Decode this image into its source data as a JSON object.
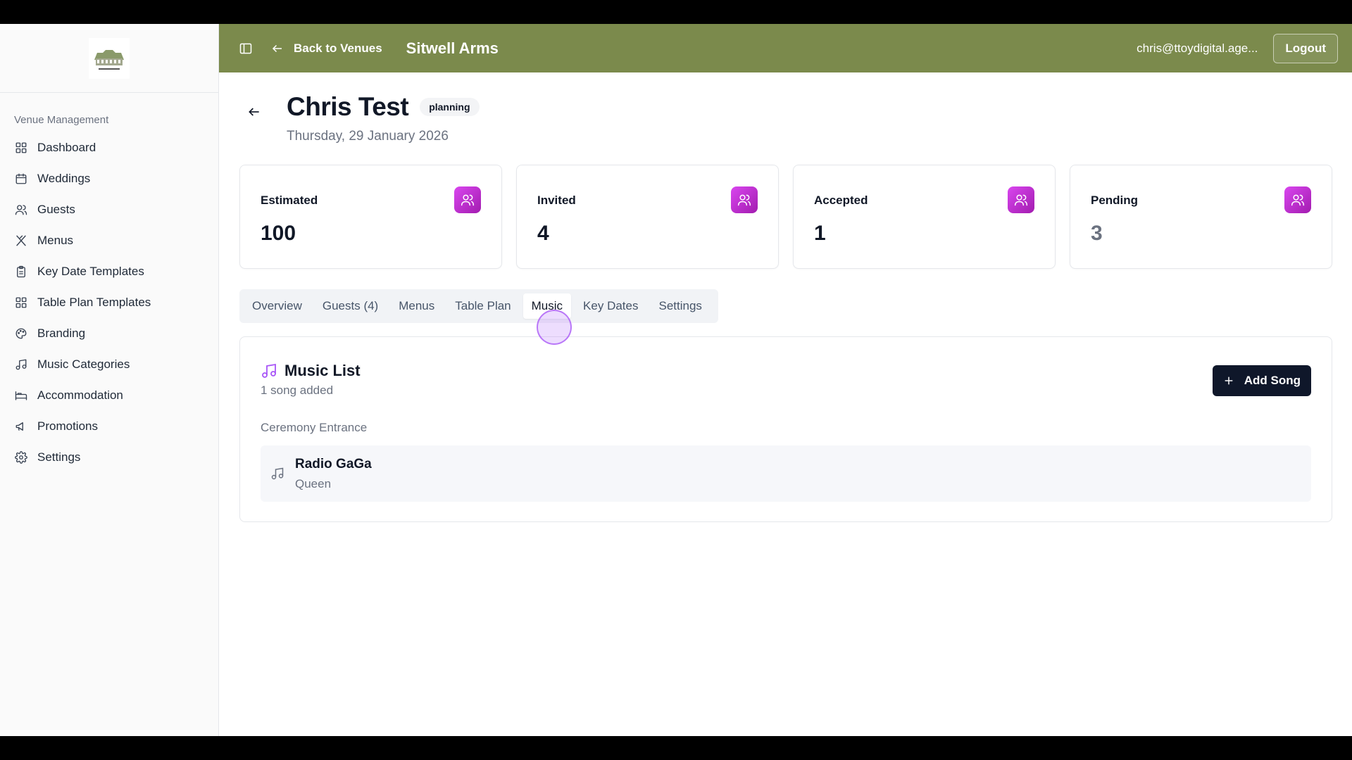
{
  "sidebar": {
    "section_label": "Venue Management",
    "items": [
      {
        "label": "Dashboard",
        "icon": "grid-icon"
      },
      {
        "label": "Weddings",
        "icon": "calendar-icon"
      },
      {
        "label": "Guests",
        "icon": "users-icon"
      },
      {
        "label": "Menus",
        "icon": "utensils-icon"
      },
      {
        "label": "Key Date Templates",
        "icon": "clipboard-icon"
      },
      {
        "label": "Table Plan Templates",
        "icon": "grid-icon"
      },
      {
        "label": "Branding",
        "icon": "palette-icon"
      },
      {
        "label": "Music Categories",
        "icon": "music-icon"
      },
      {
        "label": "Accommodation",
        "icon": "bed-icon"
      },
      {
        "label": "Promotions",
        "icon": "megaphone-icon"
      },
      {
        "label": "Settings",
        "icon": "gear-icon"
      }
    ]
  },
  "header": {
    "back_label": "Back to Venues",
    "venue_title": "Sitwell Arms",
    "user_email": "chris@ttoydigital.age...",
    "logout_label": "Logout",
    "bg_color": "#7b8a4c"
  },
  "page": {
    "title": "Chris Test",
    "status": "planning",
    "date": "Thursday, 29 January 2026"
  },
  "stats": [
    {
      "label": "Estimated",
      "value": "100"
    },
    {
      "label": "Invited",
      "value": "4"
    },
    {
      "label": "Accepted",
      "value": "1"
    },
    {
      "label": "Pending",
      "value": "3"
    }
  ],
  "tabs": [
    {
      "label": "Overview"
    },
    {
      "label": "Guests (4)"
    },
    {
      "label": "Menus"
    },
    {
      "label": "Table Plan"
    },
    {
      "label": "Music"
    },
    {
      "label": "Key Dates"
    },
    {
      "label": "Settings"
    }
  ],
  "active_tab": "Music",
  "music": {
    "title": "Music List",
    "subtitle": "1 song added",
    "add_button": "Add Song",
    "categories": [
      {
        "name": "Ceremony Entrance",
        "songs": [
          {
            "title": "Radio GaGa",
            "artist": "Queen"
          }
        ]
      }
    ]
  },
  "colors": {
    "accent_gradient_start": "#d946ef",
    "accent_gradient_end": "#a21caf",
    "primary_button": "#0f172a"
  }
}
